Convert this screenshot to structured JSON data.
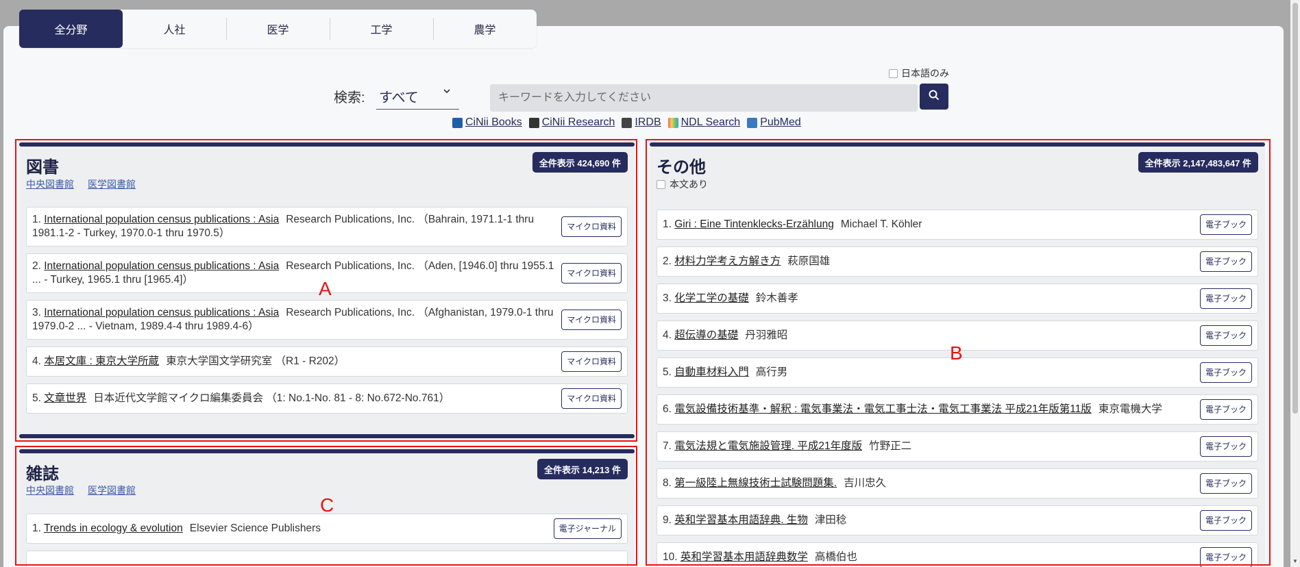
{
  "tabs": [
    "全分野",
    "人社",
    "医学",
    "工学",
    "農学"
  ],
  "search": {
    "label": "検索:",
    "scope": "すべて",
    "placeholder": "キーワードを入力してください",
    "japanese_only": "日本語のみ"
  },
  "db_links": [
    "CiNii Books",
    "CiNii Research",
    "IRDB",
    "NDL Search",
    "PubMed"
  ],
  "books": {
    "title": "図書",
    "sub_links": [
      "中央図書館",
      "医学図書館"
    ],
    "show_all": "全件表示 424,690 件",
    "items": [
      {
        "no": "1.",
        "title": "International population census publications : Asia",
        "detail": "Research Publications, Inc. （Bahrain, 1971.1-1 thru 1981.1-2 - Turkey, 1970.0-1 thru 1970.5）",
        "badge": "マイクロ資料"
      },
      {
        "no": "2.",
        "title": "International population census publications : Asia",
        "detail": "Research Publications, Inc. （Aden, [1946.0] thru 1955.1 ... - Turkey, 1965.1 thru [1965.4]）",
        "badge": "マイクロ資料"
      },
      {
        "no": "3.",
        "title": "International population census publications : Asia",
        "detail": "Research Publications, Inc. （Afghanistan, 1979.0-1 thru 1979.0-2 ... - Vietnam, 1989.4-4 thru 1989.4-6）",
        "badge": "マイクロ資料"
      },
      {
        "no": "4.",
        "title": "本居文庫 : 東京大学所蔵",
        "detail": "東京大学国文学研究室 （R1 - R202）",
        "badge": "マイクロ資料"
      },
      {
        "no": "5.",
        "title": "文章世界",
        "detail": "日本近代文学館マイクロ編集委員会 （1: No.1-No. 81 - 8: No.672-No.761）",
        "badge": "マイクロ資料"
      }
    ]
  },
  "journals": {
    "title": "雑誌",
    "sub_links": [
      "中央図書館",
      "医学図書館"
    ],
    "show_all": "全件表示 14,213 件",
    "items": [
      {
        "no": "1.",
        "title": "Trends in ecology & evolution",
        "detail": "Elsevier Science Publishers",
        "badge": "電子ジャーナル"
      }
    ]
  },
  "others": {
    "title": "その他",
    "fulltext": "本文あり",
    "show_all": "全件表示 2,147,483,647 件",
    "items": [
      {
        "no": "1.",
        "title": "Giri : Eine Tintenklecks-Erzählung",
        "detail": "Michael T. Köhler",
        "badge": "電子ブック"
      },
      {
        "no": "2.",
        "title": "材料力学考え方解き方",
        "detail": "萩原国雄",
        "badge": "電子ブック"
      },
      {
        "no": "3.",
        "title": "化学工学の基礎",
        "detail": "鈴木善孝",
        "badge": "電子ブック"
      },
      {
        "no": "4.",
        "title": "超伝導の基礎",
        "detail": "丹羽雅昭",
        "badge": "電子ブック"
      },
      {
        "no": "5.",
        "title": "自動車材料入門",
        "detail": "高行男",
        "badge": "電子ブック"
      },
      {
        "no": "6.",
        "title": "電気設備技術基準・解釈 : 電気事業法・電気工事士法・電気工事業法 平成21年版第11版",
        "detail": "東京電機大学",
        "badge": "電子ブック"
      },
      {
        "no": "7.",
        "title": "電気法規と電気施設管理. 平成21年度版",
        "detail": "竹野正二",
        "badge": "電子ブック"
      },
      {
        "no": "8.",
        "title": "第一級陸上無線技術士試験問題集.",
        "detail": "吉川忠久",
        "badge": "電子ブック"
      },
      {
        "no": "9.",
        "title": "英和学習基本用語辞典. 生物",
        "detail": "津田稔",
        "badge": "電子ブック"
      },
      {
        "no": "10.",
        "title": "英和学習基本用語辞典数学",
        "detail": "高橋伯也",
        "badge": "電子ブック"
      }
    ]
  },
  "annotations": [
    "A",
    "B",
    "C"
  ],
  "colors": {
    "navy": "#262c5e",
    "highlight": "#ee1111"
  }
}
